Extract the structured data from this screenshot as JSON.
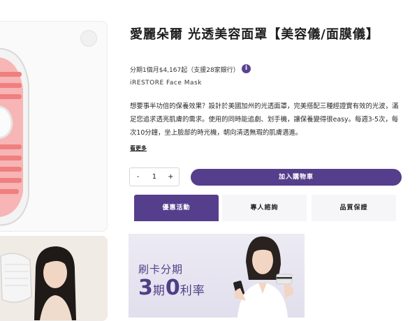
{
  "product": {
    "title": "愛麗朵爾 光透美容面罩【美容儀/面膜儀】",
    "installment": "分期1個月$4,167起（支援28家銀行）",
    "installment_info_icon": "i",
    "brand": "iRESTORE Face Mask",
    "description": "想要事半功倍的保養效果？設計於美國加州的光透面罩，完美搭配三種經證實有效的光波，滿足您追求透亮肌膚的需求。使用的同時能追劇、划手機，讓保養變得很easy。每週3-5次，每次10分鐘，坐上臉部的時光機，朝向清透無瑕的肌膚邁進。",
    "read_more": "看更多"
  },
  "purchase": {
    "minus": "-",
    "quantity": "1",
    "plus": "+",
    "add_to_cart": "加入購物車"
  },
  "tabs": [
    {
      "label": "優惠活動"
    },
    {
      "label": "專人諮詢"
    },
    {
      "label": "品質保證"
    }
  ],
  "promo": {
    "line1": "刷卡分期",
    "big1": "3",
    "unit1": "期",
    "big2": "0",
    "unit2": "利率"
  },
  "colors": {
    "accent": "#553f8c"
  }
}
